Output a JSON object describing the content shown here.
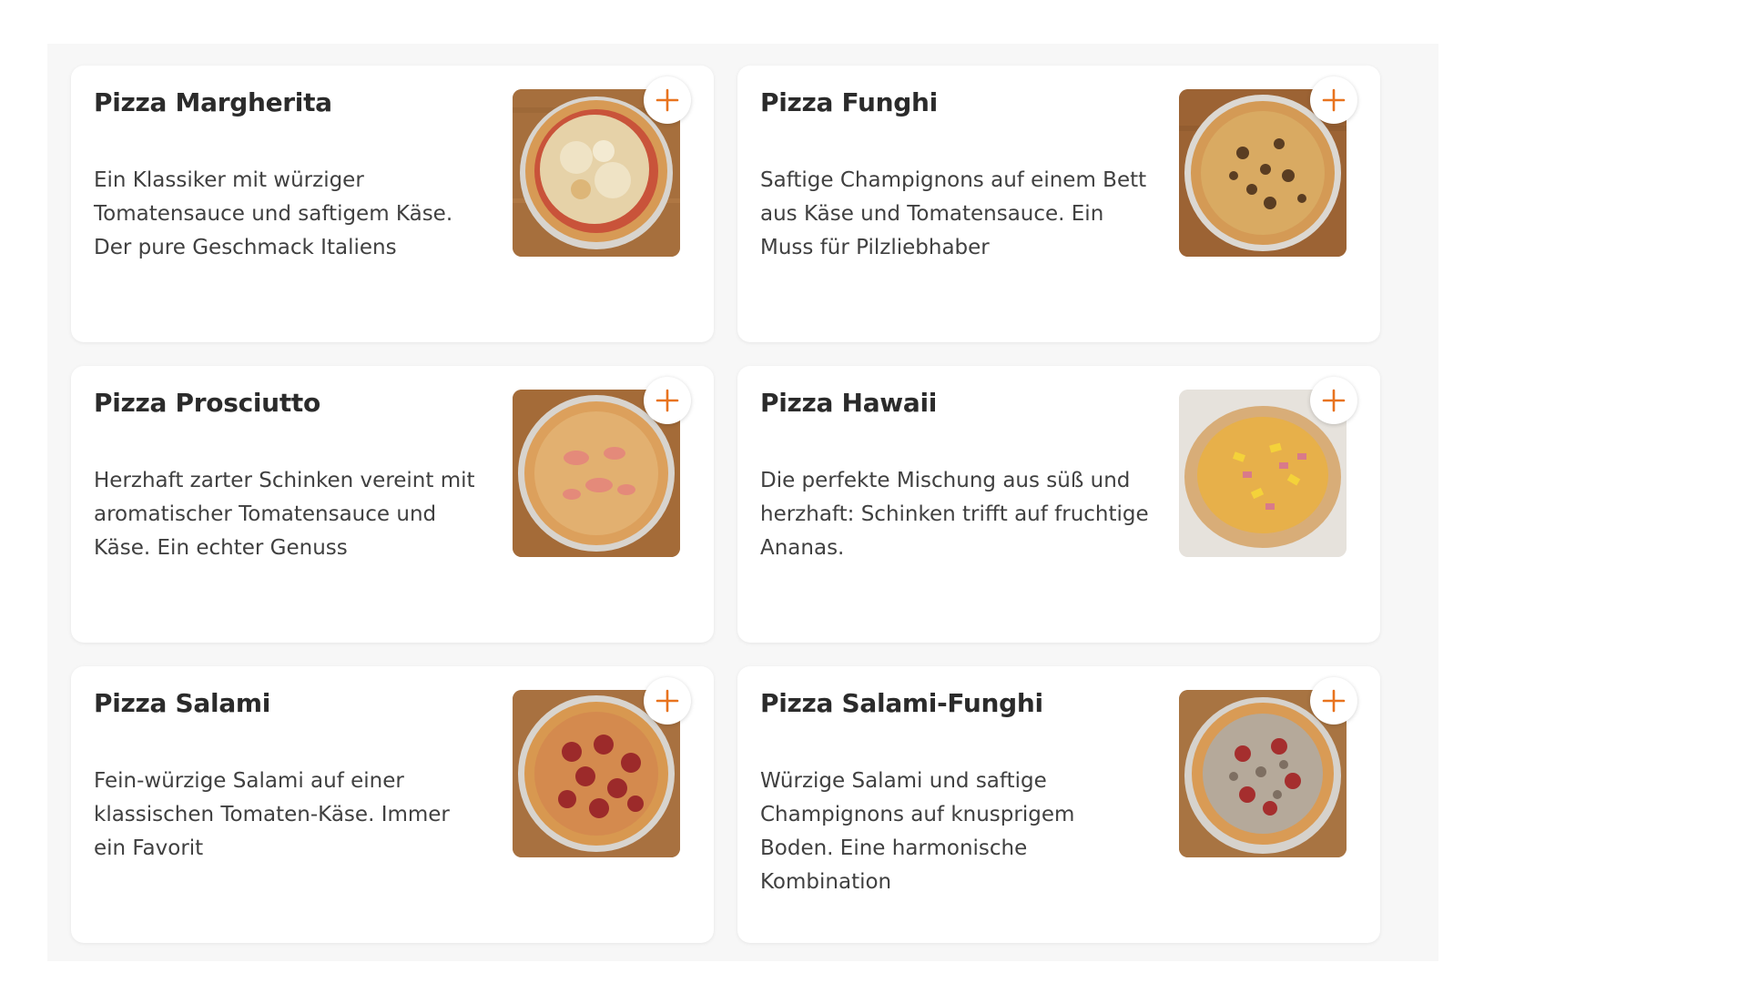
{
  "accent_color": "#e8731e",
  "add_icon": "plus-icon",
  "pizzas": [
    {
      "name": "Pizza Margherita",
      "description": "Ein Klassiker mit würziger Tomatensauce und saftigem Käse. Der pure Geschmack Italiens"
    },
    {
      "name": "Pizza Funghi",
      "description": "Saftige Champignons auf einem Bett aus Käse und Tomatensauce. Ein Muss für Pilzliebhaber"
    },
    {
      "name": "Pizza Prosciutto",
      "description": "Herzhaft zarter Schinken vereint mit aromatischer Tomatensauce und Käse. Ein echter Genuss"
    },
    {
      "name": "Pizza Hawaii",
      "description": "Die perfekte Mischung aus süß und herzhaft: Schinken trifft auf fruchtige Ananas."
    },
    {
      "name": "Pizza Salami",
      "description": "Fein-würzige Salami auf einer klassischen Tomaten-Käse. Immer ein Favorit"
    },
    {
      "name": "Pizza Salami-Funghi",
      "description": "Würzige Salami und saftige Champignons auf knusprigem Boden. Eine harmonische Kombination"
    }
  ]
}
